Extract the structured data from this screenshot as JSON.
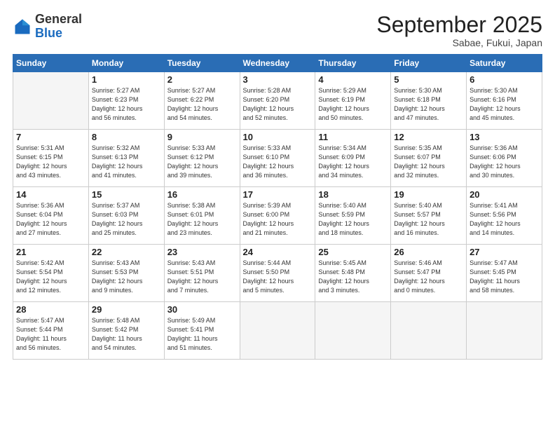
{
  "logo": {
    "general": "General",
    "blue": "Blue"
  },
  "header": {
    "month": "September 2025",
    "location": "Sabae, Fukui, Japan"
  },
  "weekdays": [
    "Sunday",
    "Monday",
    "Tuesday",
    "Wednesday",
    "Thursday",
    "Friday",
    "Saturday"
  ],
  "weeks": [
    [
      {
        "day": "",
        "info": ""
      },
      {
        "day": "1",
        "info": "Sunrise: 5:27 AM\nSunset: 6:23 PM\nDaylight: 12 hours\nand 56 minutes."
      },
      {
        "day": "2",
        "info": "Sunrise: 5:27 AM\nSunset: 6:22 PM\nDaylight: 12 hours\nand 54 minutes."
      },
      {
        "day": "3",
        "info": "Sunrise: 5:28 AM\nSunset: 6:20 PM\nDaylight: 12 hours\nand 52 minutes."
      },
      {
        "day": "4",
        "info": "Sunrise: 5:29 AM\nSunset: 6:19 PM\nDaylight: 12 hours\nand 50 minutes."
      },
      {
        "day": "5",
        "info": "Sunrise: 5:30 AM\nSunset: 6:18 PM\nDaylight: 12 hours\nand 47 minutes."
      },
      {
        "day": "6",
        "info": "Sunrise: 5:30 AM\nSunset: 6:16 PM\nDaylight: 12 hours\nand 45 minutes."
      }
    ],
    [
      {
        "day": "7",
        "info": "Sunrise: 5:31 AM\nSunset: 6:15 PM\nDaylight: 12 hours\nand 43 minutes."
      },
      {
        "day": "8",
        "info": "Sunrise: 5:32 AM\nSunset: 6:13 PM\nDaylight: 12 hours\nand 41 minutes."
      },
      {
        "day": "9",
        "info": "Sunrise: 5:33 AM\nSunset: 6:12 PM\nDaylight: 12 hours\nand 39 minutes."
      },
      {
        "day": "10",
        "info": "Sunrise: 5:33 AM\nSunset: 6:10 PM\nDaylight: 12 hours\nand 36 minutes."
      },
      {
        "day": "11",
        "info": "Sunrise: 5:34 AM\nSunset: 6:09 PM\nDaylight: 12 hours\nand 34 minutes."
      },
      {
        "day": "12",
        "info": "Sunrise: 5:35 AM\nSunset: 6:07 PM\nDaylight: 12 hours\nand 32 minutes."
      },
      {
        "day": "13",
        "info": "Sunrise: 5:36 AM\nSunset: 6:06 PM\nDaylight: 12 hours\nand 30 minutes."
      }
    ],
    [
      {
        "day": "14",
        "info": "Sunrise: 5:36 AM\nSunset: 6:04 PM\nDaylight: 12 hours\nand 27 minutes."
      },
      {
        "day": "15",
        "info": "Sunrise: 5:37 AM\nSunset: 6:03 PM\nDaylight: 12 hours\nand 25 minutes."
      },
      {
        "day": "16",
        "info": "Sunrise: 5:38 AM\nSunset: 6:01 PM\nDaylight: 12 hours\nand 23 minutes."
      },
      {
        "day": "17",
        "info": "Sunrise: 5:39 AM\nSunset: 6:00 PM\nDaylight: 12 hours\nand 21 minutes."
      },
      {
        "day": "18",
        "info": "Sunrise: 5:40 AM\nSunset: 5:59 PM\nDaylight: 12 hours\nand 18 minutes."
      },
      {
        "day": "19",
        "info": "Sunrise: 5:40 AM\nSunset: 5:57 PM\nDaylight: 12 hours\nand 16 minutes."
      },
      {
        "day": "20",
        "info": "Sunrise: 5:41 AM\nSunset: 5:56 PM\nDaylight: 12 hours\nand 14 minutes."
      }
    ],
    [
      {
        "day": "21",
        "info": "Sunrise: 5:42 AM\nSunset: 5:54 PM\nDaylight: 12 hours\nand 12 minutes."
      },
      {
        "day": "22",
        "info": "Sunrise: 5:43 AM\nSunset: 5:53 PM\nDaylight: 12 hours\nand 9 minutes."
      },
      {
        "day": "23",
        "info": "Sunrise: 5:43 AM\nSunset: 5:51 PM\nDaylight: 12 hours\nand 7 minutes."
      },
      {
        "day": "24",
        "info": "Sunrise: 5:44 AM\nSunset: 5:50 PM\nDaylight: 12 hours\nand 5 minutes."
      },
      {
        "day": "25",
        "info": "Sunrise: 5:45 AM\nSunset: 5:48 PM\nDaylight: 12 hours\nand 3 minutes."
      },
      {
        "day": "26",
        "info": "Sunrise: 5:46 AM\nSunset: 5:47 PM\nDaylight: 12 hours\nand 0 minutes."
      },
      {
        "day": "27",
        "info": "Sunrise: 5:47 AM\nSunset: 5:45 PM\nDaylight: 11 hours\nand 58 minutes."
      }
    ],
    [
      {
        "day": "28",
        "info": "Sunrise: 5:47 AM\nSunset: 5:44 PM\nDaylight: 11 hours\nand 56 minutes."
      },
      {
        "day": "29",
        "info": "Sunrise: 5:48 AM\nSunset: 5:42 PM\nDaylight: 11 hours\nand 54 minutes."
      },
      {
        "day": "30",
        "info": "Sunrise: 5:49 AM\nSunset: 5:41 PM\nDaylight: 11 hours\nand 51 minutes."
      },
      {
        "day": "",
        "info": ""
      },
      {
        "day": "",
        "info": ""
      },
      {
        "day": "",
        "info": ""
      },
      {
        "day": "",
        "info": ""
      }
    ]
  ]
}
